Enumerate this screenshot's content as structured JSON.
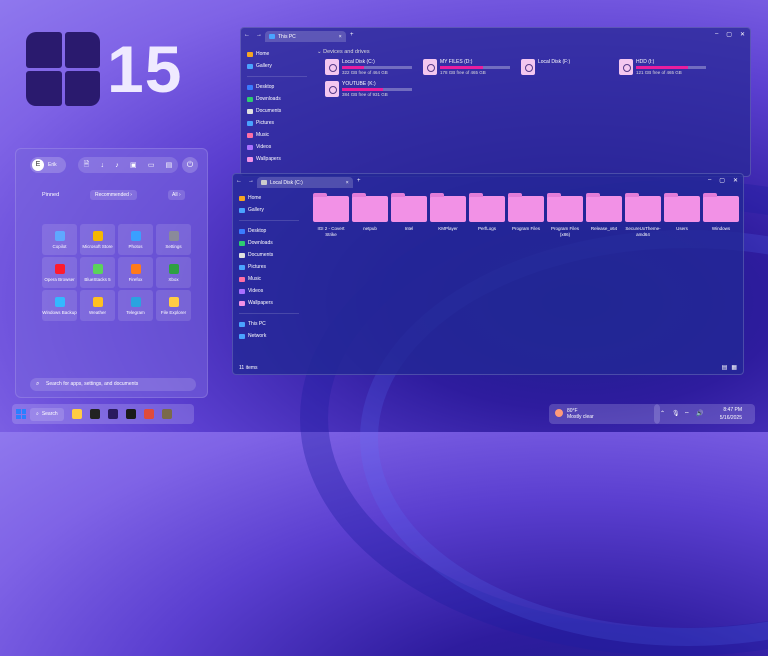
{
  "brand": {
    "number": "15"
  },
  "start_menu": {
    "user": {
      "initial": "E",
      "name": "Erik"
    },
    "quick_icons": [
      "file-icon",
      "download-icon",
      "music-icon",
      "image-icon",
      "video-icon",
      "folder-icon"
    ],
    "pinned_label": "Pinned",
    "recommended_label": "Recommended",
    "recommended_chevron": "›",
    "all_label": "All",
    "all_chevron": "›",
    "apps": [
      {
        "label": "Copilot",
        "color": "#5fa8ff"
      },
      {
        "label": "Microsoft Store",
        "color": "#f5b700"
      },
      {
        "label": "Photos",
        "color": "#3aa0ff"
      },
      {
        "label": "Settings",
        "color": "#8a8a9a"
      },
      {
        "label": "Opera Browser",
        "color": "#ff1b2d"
      },
      {
        "label": "BlueStacks 5",
        "color": "#5bd35b"
      },
      {
        "label": "Firefox",
        "color": "#ff7a1a"
      },
      {
        "label": "Xbox",
        "color": "#2ea043"
      },
      {
        "label": "Windows Backup",
        "color": "#34b8ff"
      },
      {
        "label": "Weather",
        "color": "#ffc021"
      },
      {
        "label": "Telegram",
        "color": "#2aa3e0"
      },
      {
        "label": "File Explorer",
        "color": "#ffcc44"
      }
    ],
    "search_placeholder": "Search for apps, settings, and documents"
  },
  "window_this_pc": {
    "tab_title": "This PC",
    "tab_close": "×",
    "new_tab": "+",
    "section_heading": "Devices and drives",
    "sidebar": [
      {
        "label": "Home",
        "color": "#f5a623"
      },
      {
        "label": "Gallery",
        "color": "#4aa3ff"
      },
      {
        "label": "Desktop",
        "color": "#3a7bff"
      },
      {
        "label": "Downloads",
        "color": "#2ecc71"
      },
      {
        "label": "Documents",
        "color": "#e0e0e0"
      },
      {
        "label": "Pictures",
        "color": "#4aa3ff"
      },
      {
        "label": "Music",
        "color": "#ff6fa5"
      },
      {
        "label": "Videos",
        "color": "#a970ff"
      },
      {
        "label": "Wallpapers",
        "color": "#f291e6"
      }
    ],
    "drives": [
      {
        "name": "Local Disk (C:)",
        "free": "322 GB free of 464 GB",
        "used": 0.31
      },
      {
        "name": "MY FILES (D:)",
        "free": "178 GB free of 465 GB",
        "used": 0.62
      },
      {
        "name": "Local Disk (F:)",
        "free": "",
        "used": 0
      },
      {
        "name": "HDD (I:)",
        "free": "121 GB free of 465 GB",
        "used": 0.74
      },
      {
        "name": "YOUTUBE (K:)",
        "free": "384 GB free of 931 GB",
        "used": 0.59
      }
    ]
  },
  "window_local_disk": {
    "tab_title": "Local Disk (C:)",
    "tab_close": "×",
    "new_tab": "+",
    "sidebar": [
      {
        "label": "Home",
        "color": "#f5a623"
      },
      {
        "label": "Gallery",
        "color": "#4aa3ff"
      },
      {
        "label": "Desktop",
        "color": "#3a7bff"
      },
      {
        "label": "Downloads",
        "color": "#2ecc71"
      },
      {
        "label": "Documents",
        "color": "#e0e0e0"
      },
      {
        "label": "Pictures",
        "color": "#4aa3ff"
      },
      {
        "label": "Music",
        "color": "#ff6fa5"
      },
      {
        "label": "Videos",
        "color": "#a970ff"
      },
      {
        "label": "Wallpapers",
        "color": "#f291e6"
      },
      {
        "label": "This PC",
        "color": "#4aa3ff"
      },
      {
        "label": "Network",
        "color": "#4aa3ff"
      }
    ],
    "folders": [
      "IGI 2 - Covert Strike",
      "netpub",
      "Intel",
      "KMPlayer",
      "PerfLogs",
      "Program Files",
      "Program Files (x86)",
      "Release_x64",
      "SecureUxTheme-amd64",
      "Users",
      "Windows"
    ],
    "status": "11 items"
  },
  "taskbar": {
    "search_label": "Search",
    "apps": [
      {
        "name": "file-explorer-icon",
        "color": "#ffcc44"
      },
      {
        "name": "capcut-icon",
        "color": "#222222"
      },
      {
        "name": "premiere-icon",
        "color": "#2a1a5e"
      },
      {
        "name": "chatgpt-icon",
        "color": "#1a1a1a"
      },
      {
        "name": "chrome-icon",
        "color": "#e04b3b"
      },
      {
        "name": "gimp-icon",
        "color": "#7a6a4a"
      }
    ],
    "weather_temp": "80°F",
    "weather_cond": "Mostly clear",
    "time": "8:47 PM",
    "date": "5/16/2025"
  }
}
